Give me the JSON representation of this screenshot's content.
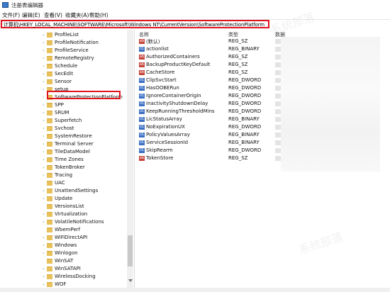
{
  "window": {
    "title": "注册表编辑器"
  },
  "menu": [
    "文件(F)",
    "编辑(E)",
    "查看(V)",
    "收藏夹(A)",
    "帮助(H)"
  ],
  "address": "计算机\\HKEY_LOCAL_MACHINE\\SOFTWARE\\Microsoft\\Windows NT\\CurrentVersion\\SoftwareProtectionPlatform",
  "tree": {
    "items": [
      {
        "label": "ProfileList",
        "expandable": true
      },
      {
        "label": "ProfileNotification",
        "expandable": true
      },
      {
        "label": "ProfileService",
        "expandable": true
      },
      {
        "label": "RemoteRegistry",
        "expandable": true
      },
      {
        "label": "Schedule",
        "expandable": true
      },
      {
        "label": "SecEdit",
        "expandable": true
      },
      {
        "label": "Sensor",
        "expandable": true
      },
      {
        "label": "setup",
        "expandable": true
      },
      {
        "label": "SoftwareProtectionPlatform",
        "expandable": true,
        "selected": true
      },
      {
        "label": "SPP",
        "expandable": true
      },
      {
        "label": "SRUM",
        "expandable": true
      },
      {
        "label": "Superfetch",
        "expandable": true
      },
      {
        "label": "Svchost",
        "expandable": true
      },
      {
        "label": "SystemRestore",
        "expandable": true
      },
      {
        "label": "Terminal Server",
        "expandable": true
      },
      {
        "label": "TileDataModel",
        "expandable": true
      },
      {
        "label": "Time Zones",
        "expandable": true
      },
      {
        "label": "TokenBroker",
        "expandable": true
      },
      {
        "label": "Tracing",
        "expandable": true
      },
      {
        "label": "UAC",
        "expandable": false
      },
      {
        "label": "UnattendSettings",
        "expandable": true
      },
      {
        "label": "Update",
        "expandable": true
      },
      {
        "label": "VersionsList",
        "expandable": false
      },
      {
        "label": "Virtualization",
        "expandable": true
      },
      {
        "label": "VolatileNotifications",
        "expandable": true
      },
      {
        "label": "WbemPerf",
        "expandable": false
      },
      {
        "label": "WiFiDirectAPI",
        "expandable": true
      },
      {
        "label": "Windows",
        "expandable": true
      },
      {
        "label": "Winlogon",
        "expandable": true
      },
      {
        "label": "WinSAT",
        "expandable": false
      },
      {
        "label": "WinSATAPI",
        "expandable": true
      },
      {
        "label": "WirelessDocking",
        "expandable": true
      },
      {
        "label": "WOF",
        "expandable": true
      }
    ]
  },
  "list": {
    "columns": {
      "name": "名称",
      "type": "类型",
      "data": "数据"
    },
    "rows": [
      {
        "name": "(默认)",
        "type": "REG_SZ",
        "kind": "sz"
      },
      {
        "name": "actionlist",
        "type": "REG_BINARY",
        "kind": "bin"
      },
      {
        "name": "AuthorizedContainers",
        "type": "REG_SZ",
        "kind": "sz"
      },
      {
        "name": "BackupProductKeyDefault",
        "type": "REG_SZ",
        "kind": "sz"
      },
      {
        "name": "CacheStore",
        "type": "REG_SZ",
        "kind": "sz"
      },
      {
        "name": "ClipSvcStart",
        "type": "REG_DWORD",
        "kind": "bin"
      },
      {
        "name": "HasOOBERun",
        "type": "REG_DWORD",
        "kind": "bin"
      },
      {
        "name": "IgnoreContainerOrigin",
        "type": "REG_DWORD",
        "kind": "bin"
      },
      {
        "name": "InactivityShutdownDelay",
        "type": "REG_DWORD",
        "kind": "bin"
      },
      {
        "name": "KeepRunningThresholdMins",
        "type": "REG_DWORD",
        "kind": "bin"
      },
      {
        "name": "LicStatusArray",
        "type": "REG_BINARY",
        "kind": "bin"
      },
      {
        "name": "NoExpirationUX",
        "type": "REG_DWORD",
        "kind": "bin"
      },
      {
        "name": "PolicyValuesArray",
        "type": "REG_BINARY",
        "kind": "bin"
      },
      {
        "name": "ServiceSessionId",
        "type": "REG_BINARY",
        "kind": "bin"
      },
      {
        "name": "SkipRearm",
        "type": "REG_DWORD",
        "kind": "bin"
      },
      {
        "name": "TokenStore",
        "type": "REG_SZ",
        "kind": "sz"
      }
    ]
  },
  "icons": {
    "string_value": "reg-sz-icon",
    "binary_value": "reg-binary-icon",
    "folder": "folder-icon",
    "expand": "chevron-right-icon"
  },
  "colors": {
    "highlight_border": "#e0141e",
    "folder": "#e9c15a"
  }
}
